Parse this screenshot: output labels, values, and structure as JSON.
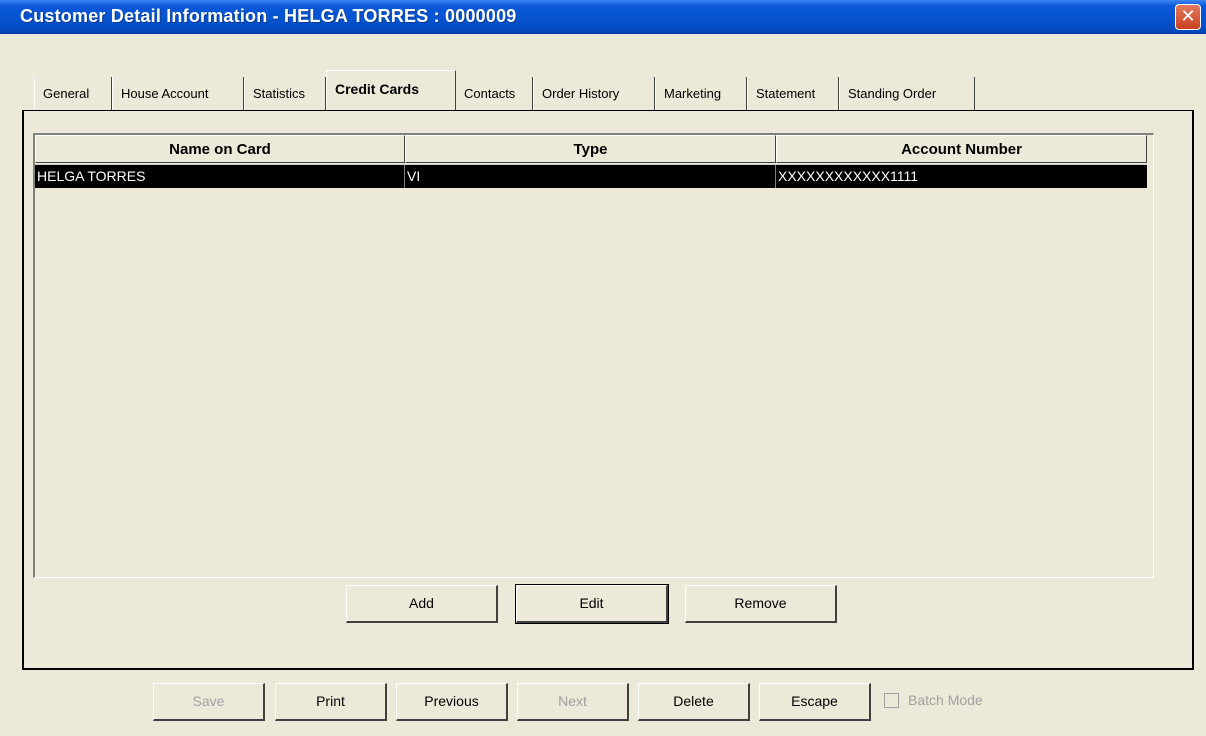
{
  "window": {
    "title": "Customer Detail Information - HELGA TORRES : 0000009",
    "close_glyph": "✕"
  },
  "tabs": [
    {
      "label": "General",
      "active": false
    },
    {
      "label": "House Account",
      "active": false
    },
    {
      "label": "Statistics",
      "active": false
    },
    {
      "label": "Credit Cards",
      "active": true
    },
    {
      "label": "Contacts",
      "active": false
    },
    {
      "label": "Order History",
      "active": false
    },
    {
      "label": "Marketing",
      "active": false
    },
    {
      "label": "Statement",
      "active": false
    },
    {
      "label": "Standing Order",
      "active": false
    }
  ],
  "grid": {
    "columns": [
      "Name on Card",
      "Type",
      "Account Number"
    ],
    "rows": [
      {
        "name": "HELGA TORRES",
        "type": "VI",
        "account": "XXXXXXXXXXXX1111",
        "selected": true
      }
    ]
  },
  "card_buttons": {
    "add": "Add",
    "edit": "Edit",
    "remove": "Remove"
  },
  "footer": {
    "save": "Save",
    "print": "Print",
    "previous": "Previous",
    "next": "Next",
    "delete": "Delete",
    "escape": "Escape",
    "batch_mode": "Batch Mode",
    "batch_mode_checked": false
  },
  "colors": {
    "title_bar": "#0653cf",
    "window_bg": "#ece9d8",
    "selection": "#000000"
  }
}
